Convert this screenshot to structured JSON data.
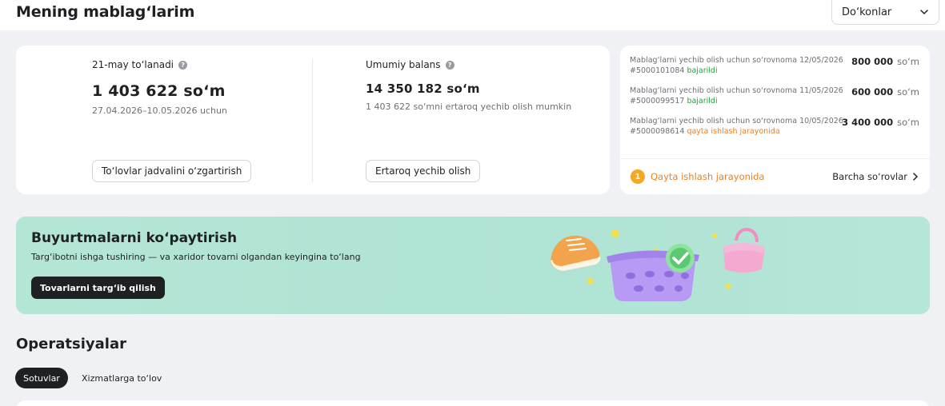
{
  "header": {
    "title": "Mening mablag‘larim",
    "shops_dropdown": "Do‘konlar"
  },
  "payout": {
    "label": "21-may to‘lanadi",
    "amount": "1 403 622 so‘m",
    "period": "27.04.2026–10.05.2026 uchun",
    "schedule_button": "To‘lovlar jadvalini o‘zgartirish"
  },
  "balance": {
    "label": "Umumiy balans",
    "amount": "14 350 182 so‘m",
    "note": "1 403 622 so‘mni ertaroq yechib olish mumkin",
    "early_button": "Ertaroq yechib olish"
  },
  "requests": {
    "items": [
      {
        "title": "Mablag‘larni yechib olish uchun so‘rovnoma 12/05/2026",
        "id": "#5000101084",
        "status": "bajarildi",
        "amount": "800 000",
        "currency": "so‘m"
      },
      {
        "title": "Mablag‘larni yechib olish uchun so‘rovnoma 11/05/2026",
        "id": "#5000099517",
        "status": "bajarildi",
        "amount": "600 000",
        "currency": "so‘m"
      },
      {
        "title": "Mablag‘larni yechib olish uchun so‘rovnoma 10/05/2026",
        "id": "#5000098614",
        "status": "qayta ishlash jarayonida",
        "amount": "3 400 000",
        "currency": "so‘m"
      }
    ],
    "processing_count": "1",
    "processing_label": "Qayta ishlash jarayonida",
    "all_link": "Barcha so‘rovlar"
  },
  "promo": {
    "title": "Buyurtmalarni ko‘paytirish",
    "subtitle": "Targ‘ibotni ishga tushiring — va xaridor tovarni olgandan keyingina to‘lang",
    "button": "Tovarlarni targ‘ib qilish"
  },
  "operations": {
    "title": "Operatsiyalar",
    "tabs": [
      "Sotuvlar",
      "Xizmatlarga to‘lov"
    ]
  },
  "colors": {
    "accent_dark": "#1f2024",
    "status_done": "#2a9d43",
    "status_processing": "#ee7f1c",
    "promo_bg": "#b4e6d6"
  },
  "icons": [
    "question-icon",
    "chevron-down-icon",
    "chevron-right-icon",
    "sneaker-illustration",
    "basket-illustration",
    "checkmark-illustration",
    "handbag-illustration"
  ]
}
